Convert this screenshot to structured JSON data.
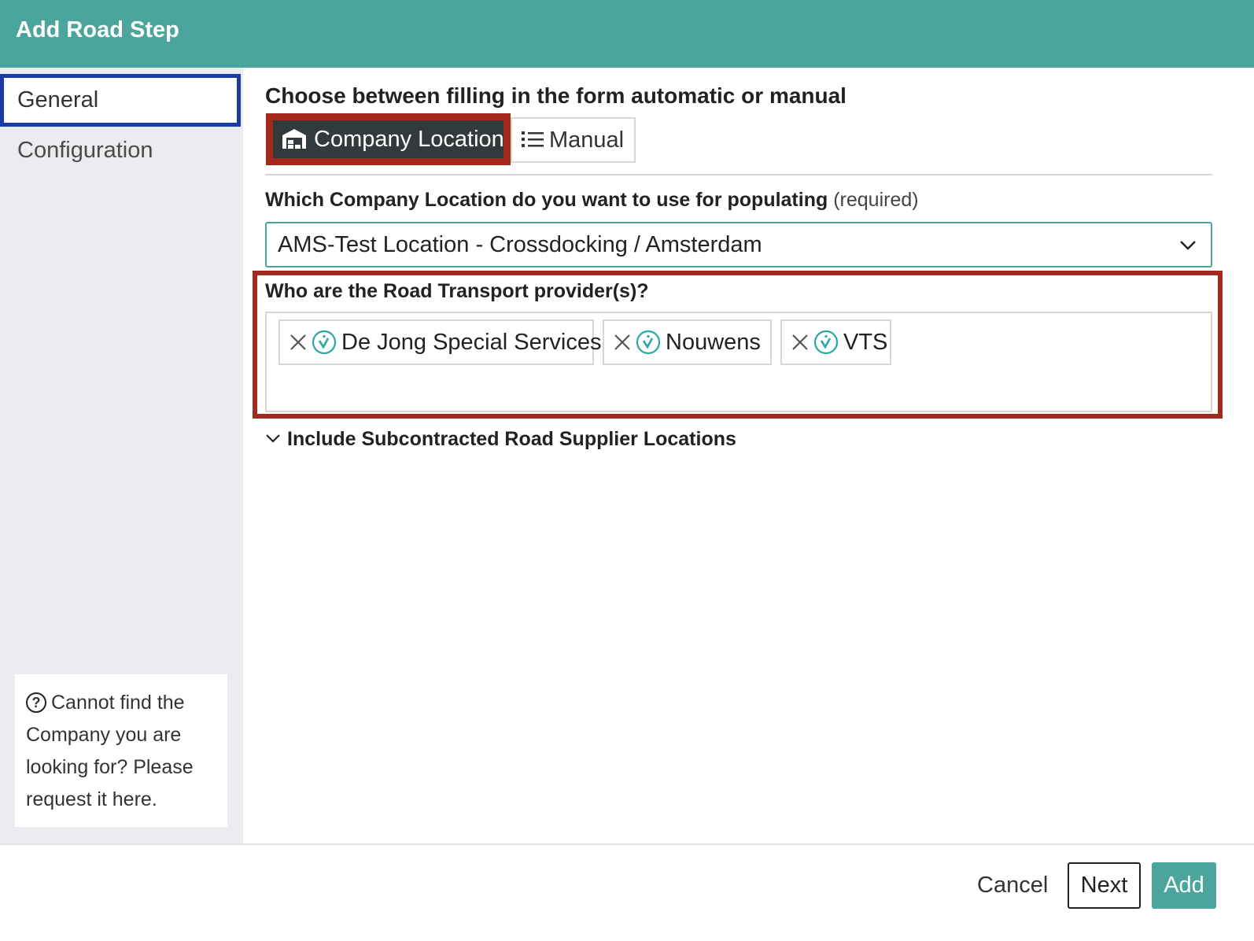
{
  "header": {
    "title": "Add Road Step",
    "color": "#4ba59c"
  },
  "sidebar": {
    "items": [
      {
        "label": "General",
        "active": true
      },
      {
        "label": "Configuration",
        "active": false
      }
    ],
    "help": {
      "icon": "question-circle-icon",
      "text": "Cannot find the Company you are looking for? Please request it here."
    }
  },
  "main": {
    "mode_question": "Choose between filling in the form automatic or manual",
    "mode_options": [
      {
        "label": "Company Location",
        "icon": "warehouse-icon",
        "selected": true
      },
      {
        "label": "Manual",
        "icon": "list-icon",
        "selected": false
      }
    ],
    "location_question": "Which Company Location do you want to use for populating",
    "location_required": "(required)",
    "location_selected": "AMS-Test Location - Crossdocking / Amsterdam",
    "providers_question": "Who are the Road Transport provider(s)?",
    "providers": [
      {
        "name": "De Jong Special Services",
        "verified": true
      },
      {
        "name": "Nouwens",
        "verified": true
      },
      {
        "name": "VTS",
        "verified": true
      }
    ],
    "subcontracted_toggle": "Include Subcontracted Road Supplier Locations"
  },
  "footer": {
    "cancel": "Cancel",
    "next": "Next",
    "add": "Add"
  },
  "highlights": {
    "red": "#a3291d",
    "blue": "#1a3aa8"
  }
}
